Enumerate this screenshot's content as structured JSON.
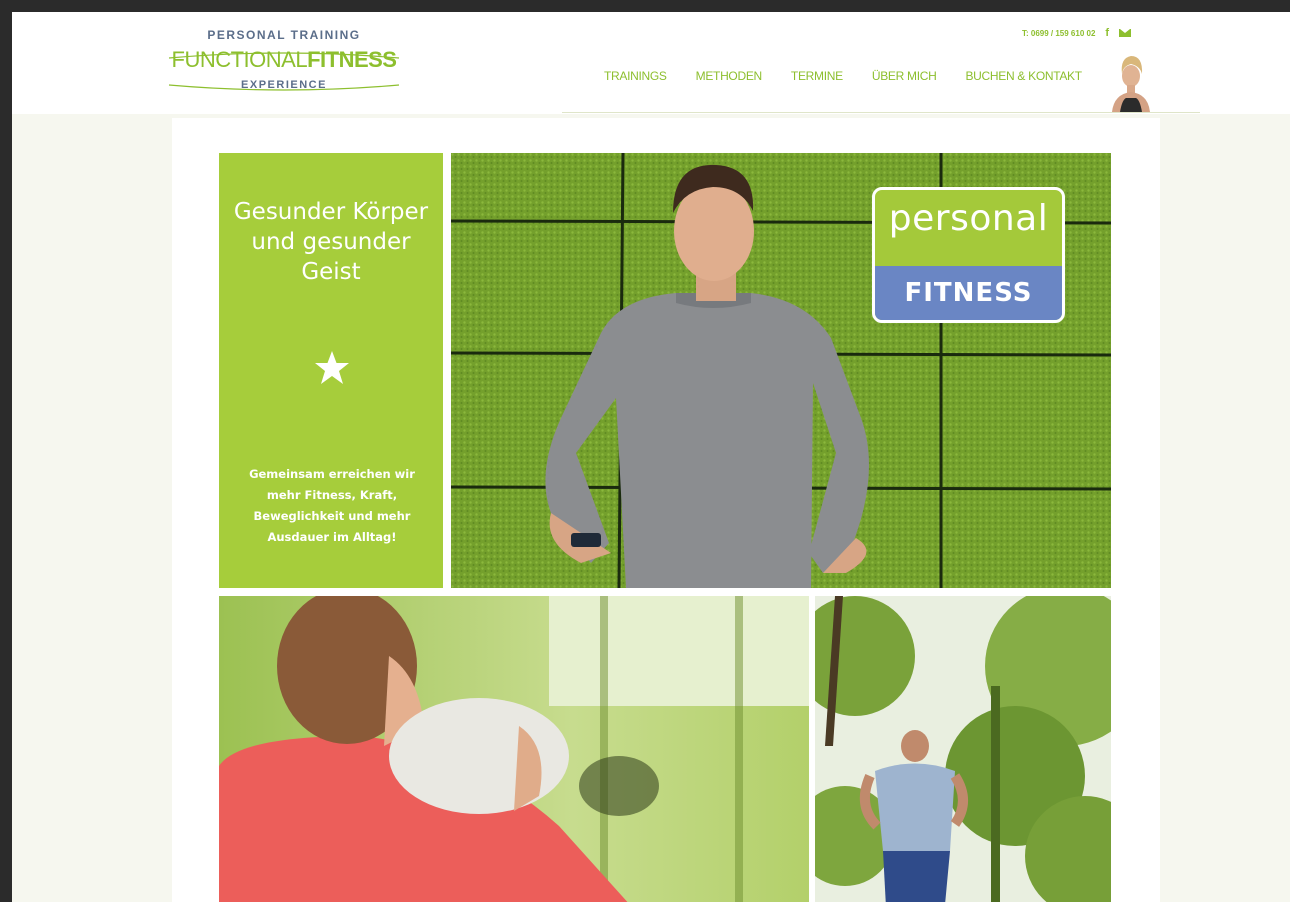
{
  "header": {
    "logo": {
      "top": "PERSONAL TRAINING",
      "main_light": "FUNCTIONAL",
      "main_bold": "FITNESS",
      "bottom": "EXPERIENCE"
    },
    "phone": "T: 0699 / 159 610 02",
    "nav": [
      "TRAININGS",
      "METHODEN",
      "TERMINE",
      "ÜBER MICH",
      "BUCHEN & KONTAKT"
    ]
  },
  "intro_panel": {
    "headline": "Gesunder Körper und gesunder Geist",
    "text": "Gemeinsam erreichen wir mehr Fitness, Kraft, Beweglichkeit und mehr Ausdauer im Alltag!"
  },
  "badge": {
    "top": "personal",
    "bottom": "FITNESS"
  },
  "colors": {
    "brand_green": "#a6cd3b",
    "brand_blue": "#6a86c4",
    "logo_navy": "#5b6e8a"
  },
  "icons": [
    "facebook-icon",
    "mail-icon",
    "star-icon"
  ]
}
